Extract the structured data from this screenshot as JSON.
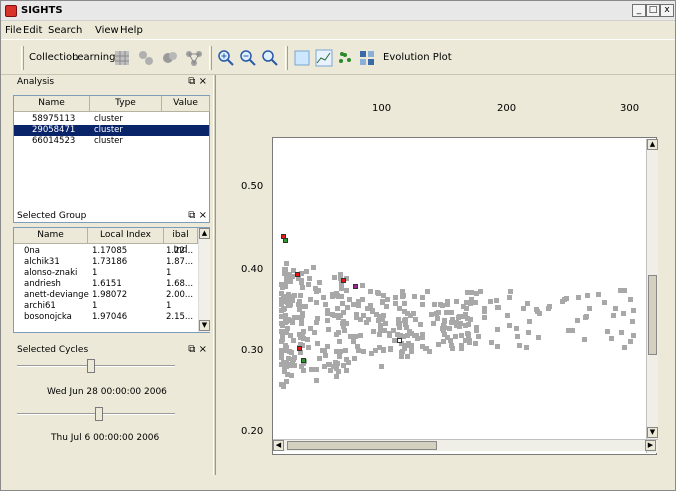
{
  "app": {
    "title": "SIGHTS",
    "brand_color": "#d8322a",
    "selection_color": "#0a246a"
  },
  "window_buttons": [
    {
      "name": "minimize-button",
      "label": "_"
    },
    {
      "name": "maximize-button",
      "label": "□"
    },
    {
      "name": "close-button",
      "label": "x"
    }
  ],
  "menu": [
    "File",
    "Edit",
    "Search",
    "View",
    "Help"
  ],
  "toolbar": {
    "collection_label": "Collection",
    "learning_label": "Learning",
    "evolution_plot_label": "Evolution Plot",
    "icons": [
      "grid-icon",
      "nodes-icon",
      "cluster-icon",
      "network-icon",
      "zoom-in-icon",
      "zoom-out-icon",
      "zoom-reset-icon",
      "blank-icon",
      "line-plot-icon",
      "scatter-icon",
      "matrix-icon"
    ]
  },
  "analysis": {
    "title": "Analysis",
    "columns": [
      "Name",
      "Type",
      "Value"
    ],
    "rows": [
      {
        "name": "58975113",
        "type": "cluster",
        "value": ""
      },
      {
        "name": "29058471",
        "type": "cluster",
        "value": "",
        "selected": true
      },
      {
        "name": "66014523",
        "type": "cluster",
        "value": ""
      }
    ]
  },
  "selected_group": {
    "title": "Selected Group",
    "columns": [
      "Name",
      "Local Index",
      "ibal Ind"
    ],
    "rows": [
      [
        "0na",
        "1.17085",
        "1.22..."
      ],
      [
        "alchik31",
        "1.73186",
        "1.87..."
      ],
      [
        "alonso-znaki",
        "1",
        "1"
      ],
      [
        "andriesh",
        "1.6151",
        "1.68..."
      ],
      [
        "anett-deviange",
        "1.98072",
        "2.00..."
      ],
      [
        "archi61",
        "1",
        "1"
      ],
      [
        "bosonojcka",
        "1.97046",
        "2.15..."
      ]
    ]
  },
  "selected_cycles": {
    "title": "Selected Cycles",
    "start_label": "Wed Jun 28 00:00:00 2006",
    "end_label": "Thu Jul 6 00:00:00 2006"
  },
  "plot": {
    "x_ticks": [
      "100",
      "200",
      "300"
    ],
    "y_ticks": [
      "0.50",
      "0.40",
      "0.30",
      "0.20"
    ],
    "point_color": "#a8a8a8",
    "highlight_colors": {
      "red": "#e01818",
      "green": "#2a9a2a",
      "purple": "#9a2a8a"
    }
  }
}
